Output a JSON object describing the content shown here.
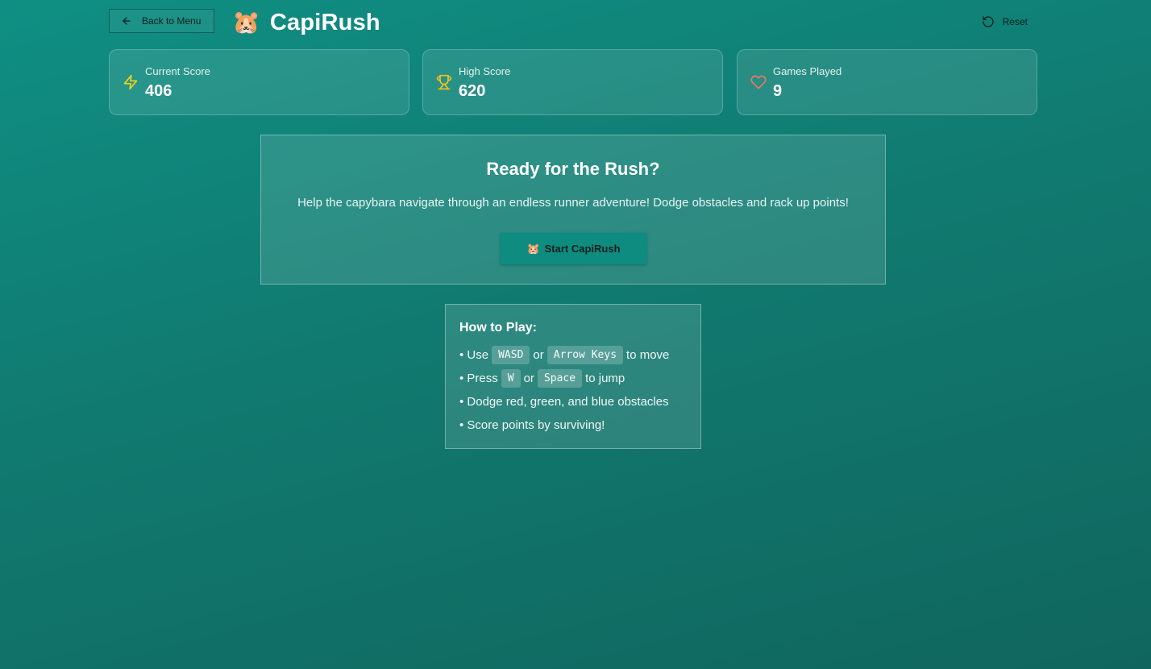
{
  "header": {
    "back_label": "Back to Menu",
    "brand_icon": "🐹",
    "title": "CapiRush",
    "reset_label": "Reset"
  },
  "stats": [
    {
      "label": "Current Score",
      "value": "406",
      "icon": "lightning-icon",
      "color": "#f2d21b"
    },
    {
      "label": "High Score",
      "value": "620",
      "icon": "trophy-icon",
      "color": "#f2c21b"
    },
    {
      "label": "Games Played",
      "value": "9",
      "icon": "heart-icon",
      "color": "#f07468"
    }
  ],
  "ready": {
    "title": "Ready for the Rush?",
    "description": "Help the capybara navigate through an endless runner adventure! Dodge obstacles and rack up points!",
    "start_icon": "🐹",
    "start_label": "Start CapiRush"
  },
  "howto": {
    "title": "How to Play:",
    "line1": {
      "pre": "• Use",
      "key1": "WASD",
      "mid": "or",
      "key2": "Arrow Keys",
      "post": "to move"
    },
    "line2": {
      "pre": "• Press",
      "key1": "W",
      "mid": "or",
      "key2": "Space",
      "post": "to jump"
    },
    "line3": "• Dodge red, green, and blue obstacles",
    "line4": "• Score points by surviving!"
  }
}
